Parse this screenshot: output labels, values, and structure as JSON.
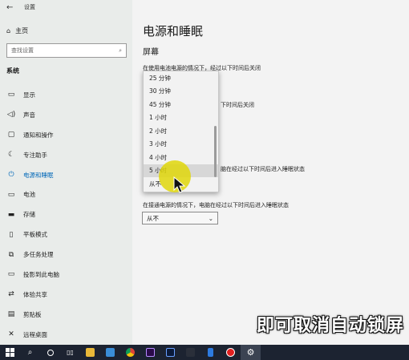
{
  "window": {
    "title": "设置"
  },
  "sidebar": {
    "home_label": "主页",
    "search_placeholder": "查找设置",
    "section": "系统",
    "items": [
      {
        "label": "显示",
        "icon": "monitor-icon"
      },
      {
        "label": "声音",
        "icon": "speaker-icon"
      },
      {
        "label": "通知和操作",
        "icon": "notification-icon"
      },
      {
        "label": "专注助手",
        "icon": "moon-icon"
      },
      {
        "label": "电源和睡眠",
        "icon": "power-icon",
        "active": true
      },
      {
        "label": "电池",
        "icon": "battery-icon"
      },
      {
        "label": "存储",
        "icon": "storage-icon"
      },
      {
        "label": "平板模式",
        "icon": "tablet-icon"
      },
      {
        "label": "多任务处理",
        "icon": "multitask-icon"
      },
      {
        "label": "投影到此电脑",
        "icon": "project-icon"
      },
      {
        "label": "体验共享",
        "icon": "share-icon"
      },
      {
        "label": "剪贴板",
        "icon": "clipboard-icon"
      },
      {
        "label": "远程桌面",
        "icon": "remote-icon"
      }
    ]
  },
  "main": {
    "title": "电源和睡眠",
    "screen_heading": "屏幕",
    "battery_screen_label": "在使用电池电源的情况下，经过以下时间后关闭",
    "plugged_screen_label": "下时间后关闭",
    "battery_sleep_label": "脑在经过以下时间后进入睡眠状态",
    "plugged_sleep_label": "在接通电源的情况下，电脑在经过以下时间后进入睡眠状态",
    "plugged_sleep_value": "从不"
  },
  "dropdown": {
    "options": [
      "25 分钟",
      "30 分钟",
      "45 分钟",
      "1 小时",
      "2 小时",
      "3 小时",
      "4 小时",
      "5 小时",
      "从不"
    ],
    "hovered": "5 小时"
  },
  "caption": "即可取消自动锁屏",
  "colors": {
    "accent": "#0067b8",
    "highlight": "#e1d70a",
    "taskbar": "#1c2331"
  }
}
